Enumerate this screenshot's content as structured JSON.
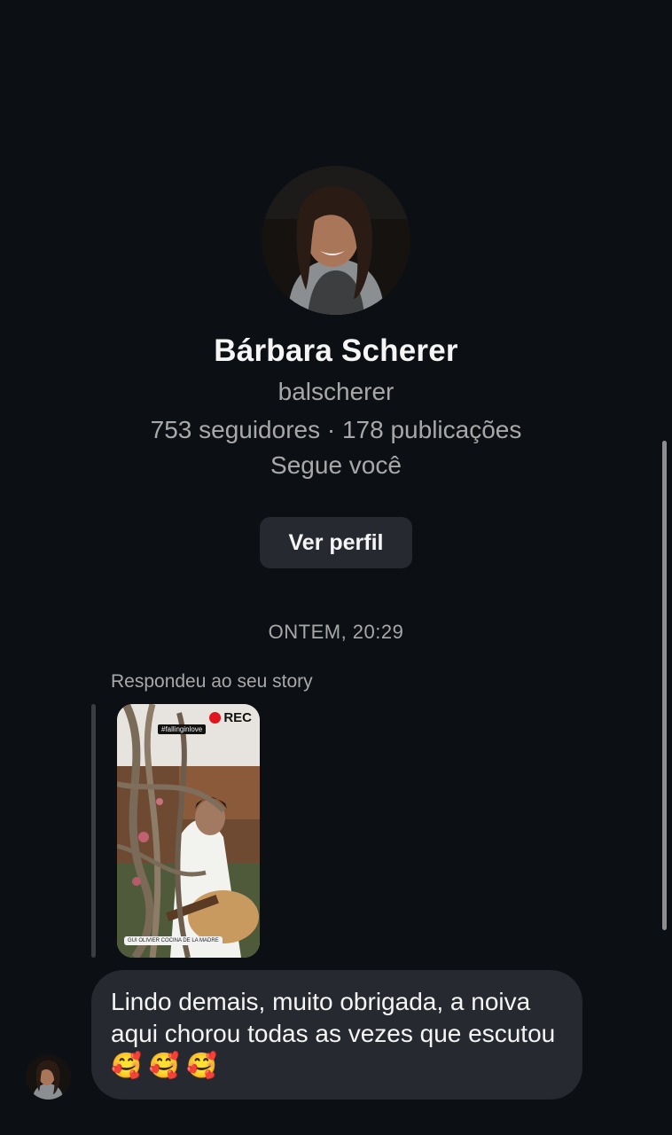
{
  "profile": {
    "name": "Bárbara Scherer",
    "username": "balscherer",
    "stats": "753 seguidores · 178 publicações",
    "follows_status": "Segue você",
    "view_profile_label": "Ver perfil"
  },
  "thread": {
    "timestamp": "ONTEM, 20:29",
    "story_reply_label": "Respondeu ao seu story",
    "story": {
      "rec_label": "REC",
      "tag": "#fallinginlove",
      "location": "GUI OLIVIER COCINA DE LA MADRE"
    },
    "message": {
      "text": "Lindo demais, muito obrigada, a noiva aqui chorou todas as vezes que escutou🥰 🥰 🥰"
    }
  }
}
